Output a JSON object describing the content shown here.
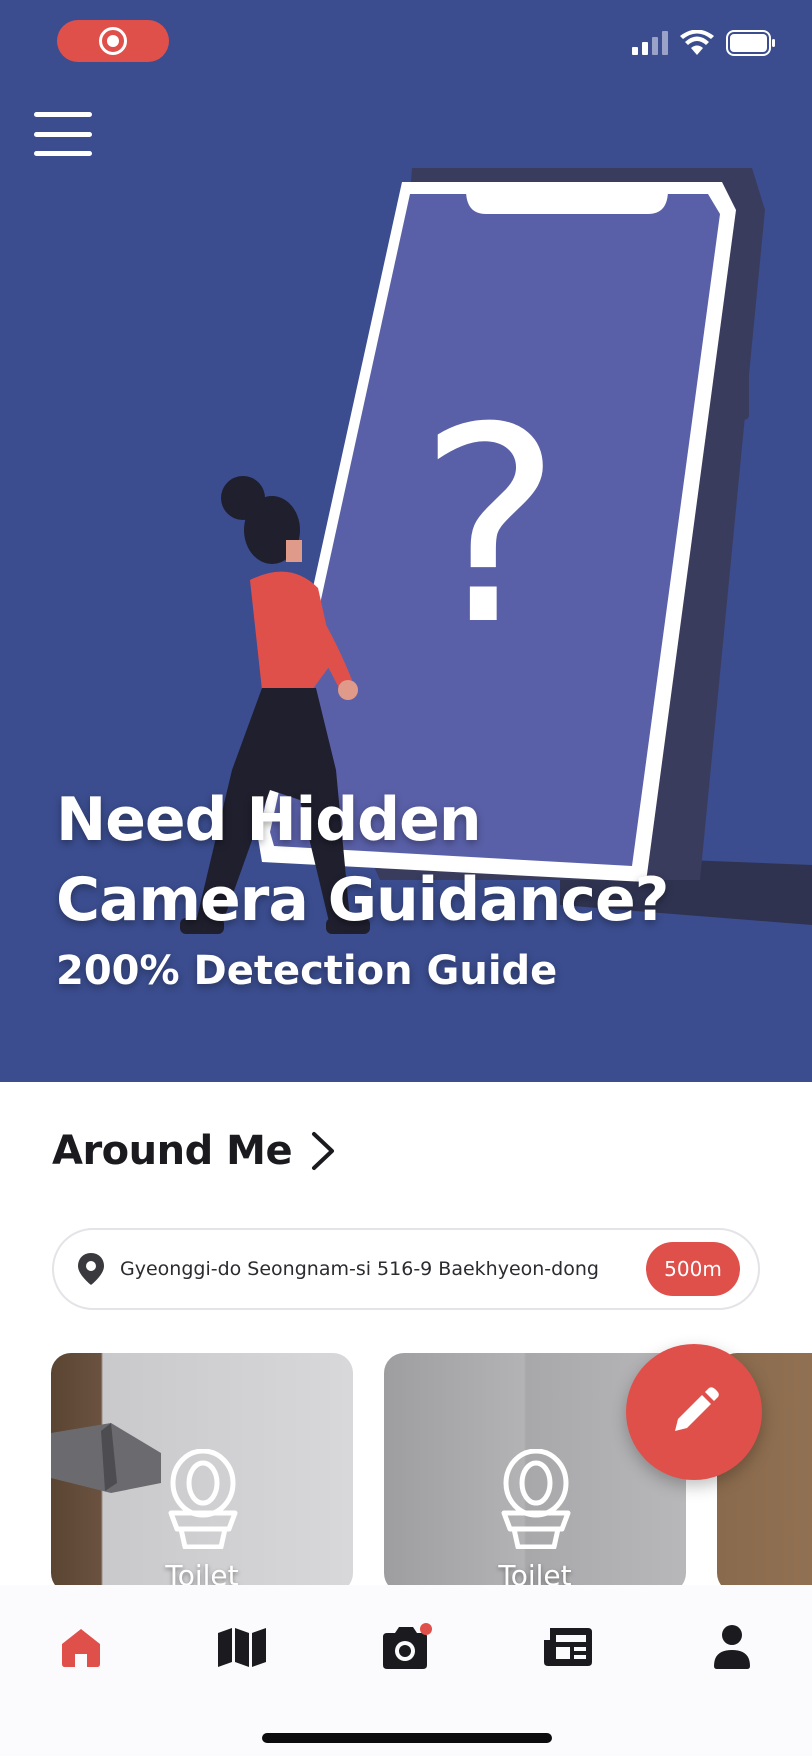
{
  "hero": {
    "title_line1": "Need Hidden",
    "title_line2": "Camera Guidance?",
    "subtitle": "200% Detection Guide",
    "background_color": "#3b4d8f",
    "illustration": "person-looking-at-phone-question-mark"
  },
  "status_bar": {
    "recording_icon": "screen-record-icon",
    "signal_icon": "cellular-signal-icon",
    "wifi_icon": "wifi-icon",
    "battery_icon": "battery-icon"
  },
  "menu": {
    "icon": "hamburger-menu-icon"
  },
  "around_me": {
    "title": "Around Me",
    "chevron_icon": "chevron-right-icon"
  },
  "location": {
    "icon": "location-pin-icon",
    "address": "Gyeonggi-do Seongnam-si 516-9 Baekhyeon-dong",
    "distance": "500m"
  },
  "cards": [
    {
      "label": "Toilet",
      "icon": "toilet-icon"
    },
    {
      "label": "Toilet",
      "icon": "toilet-icon"
    }
  ],
  "fab": {
    "icon": "pencil-icon"
  },
  "tabs": [
    {
      "name": "home",
      "icon": "home-icon",
      "active": true
    },
    {
      "name": "map",
      "icon": "map-icon",
      "active": false
    },
    {
      "name": "camera",
      "icon": "camera-icon",
      "active": false,
      "badge": true
    },
    {
      "name": "news",
      "icon": "newspaper-icon",
      "active": false
    },
    {
      "name": "profile",
      "icon": "person-icon",
      "active": false
    }
  ],
  "colors": {
    "accent": "#e0504b",
    "hero_blue": "#3b4d8f",
    "phone_screen": "#5a60a8",
    "dark": "#1b1b1f"
  }
}
